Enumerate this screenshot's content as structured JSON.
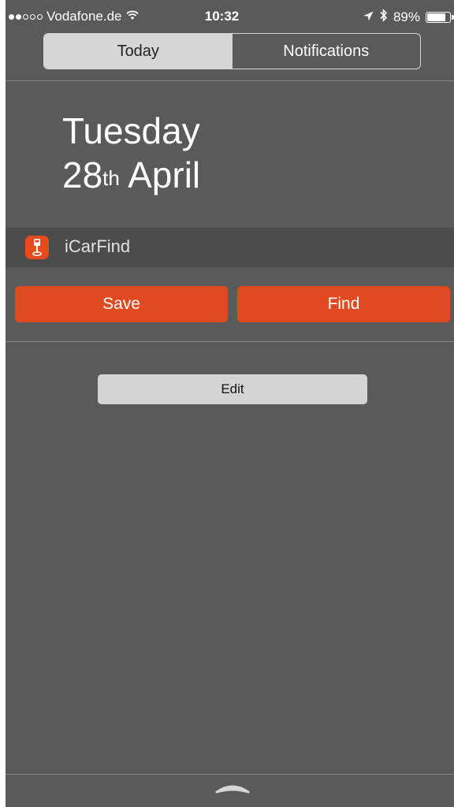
{
  "status_bar": {
    "carrier": "Vodafone.de",
    "signal_bars_filled": 2,
    "signal_bars_total": 5,
    "time": "10:32",
    "battery_percent": "89%",
    "battery_level": 0.89,
    "icons": [
      "wifi-icon",
      "location-arrow-icon",
      "bluetooth-icon",
      "battery-icon"
    ]
  },
  "tabs": [
    {
      "label": "Today",
      "selected": true
    },
    {
      "label": "Notifications",
      "selected": false
    }
  ],
  "date": {
    "weekday": "Tuesday",
    "day": "28",
    "ordinal_suffix": "th",
    "month": "April"
  },
  "widget": {
    "app_name": "iCarFind",
    "icon": "car-pin-icon",
    "accent_color": "#e04a20",
    "buttons": [
      {
        "label": "Save"
      },
      {
        "label": "Find"
      }
    ]
  },
  "edit_button": {
    "label": "Edit"
  },
  "footer": {
    "icon": "grabber-handle-icon"
  }
}
